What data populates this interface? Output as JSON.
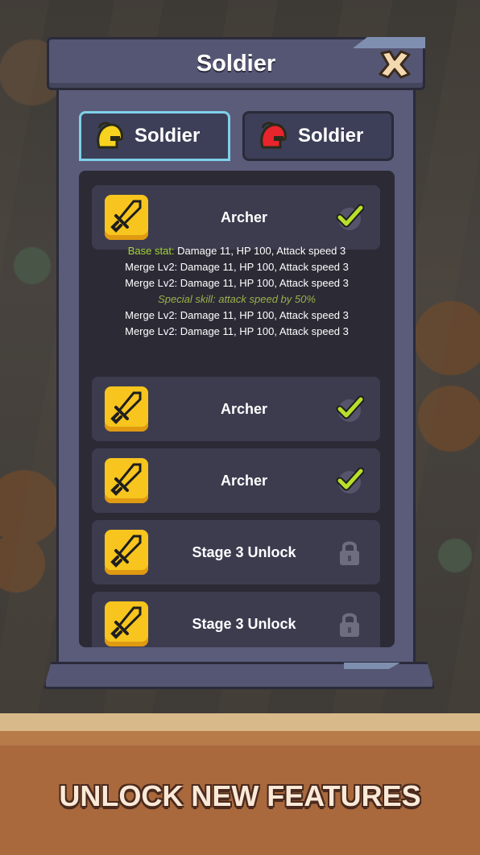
{
  "window": {
    "title": "Soldier",
    "close_icon": "close-x-icon"
  },
  "tabs": [
    {
      "label": "Soldier",
      "icon": "gold-helmet-icon",
      "icon_color": "#f7d21e",
      "active": true
    },
    {
      "label": "Soldier",
      "icon": "red-helmet-icon",
      "icon_color": "#e8242c",
      "active": false
    }
  ],
  "items": [
    {
      "name": "Archer",
      "icon": "sword-icon",
      "status": "unlocked"
    },
    {
      "name": "Archer",
      "icon": "sword-icon",
      "status": "unlocked"
    },
    {
      "name": "Archer",
      "icon": "sword-icon",
      "status": "unlocked"
    },
    {
      "name": "Stage 3 Unlock",
      "icon": "sword-icon",
      "status": "locked"
    },
    {
      "name": "Stage 3 Unlock",
      "icon": "sword-icon",
      "status": "locked"
    }
  ],
  "details": {
    "base_label": "Base stat:",
    "base_value": " Damage 11, HP 100, Attack speed 3",
    "lines": [
      "Merge Lv2: Damage 11, HP 100, Attack speed 3",
      "Merge Lv2: Damage 11, HP 100, Attack speed 3"
    ],
    "special": "Special skill: attack speed by 50%",
    "lines_after": [
      "Merge Lv2: Damage 11, HP 100, Attack speed 3",
      "Merge Lv2: Damage 11, HP 100, Attack speed 3"
    ]
  },
  "banner": {
    "text": "UNLOCK NEW FEATURES"
  },
  "colors": {
    "panel": "#545673",
    "tab_active_border": "#7fd0e8",
    "item_icon_bg": "#f7c51e",
    "check": "#b8e02a",
    "green_label": "#a5d63a"
  }
}
